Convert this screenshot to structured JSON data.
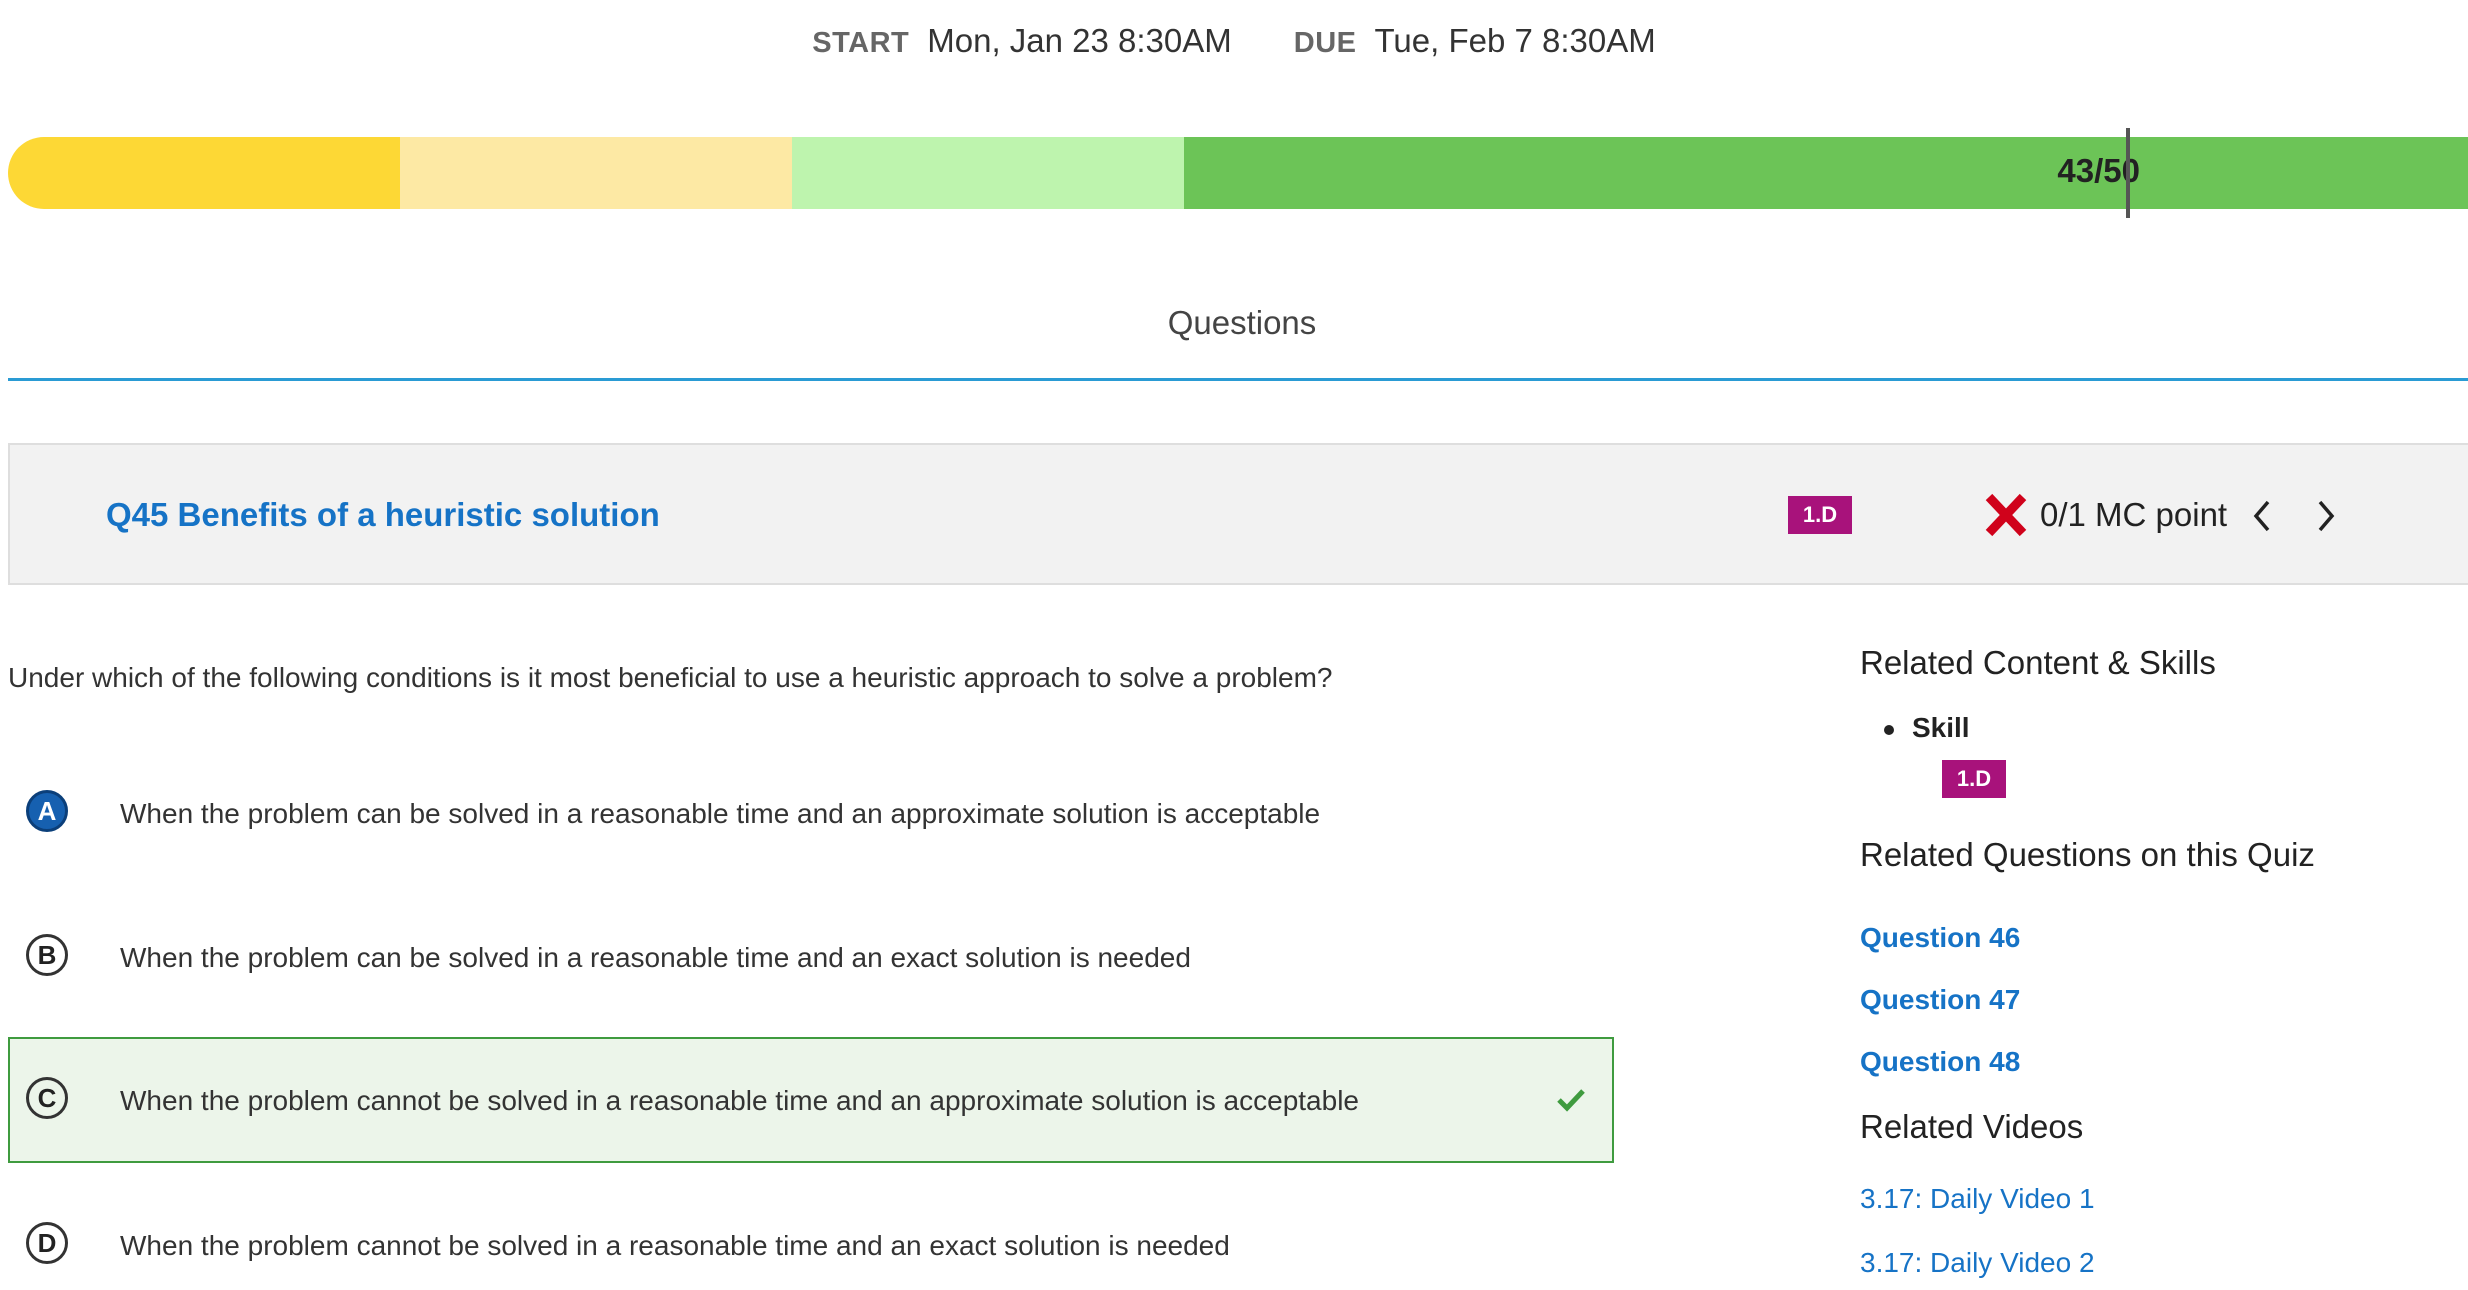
{
  "header": {
    "start_label": "START",
    "start_value": "Mon, Jan 23 8:30AM",
    "due_label": "DUE",
    "due_value": "Tue, Feb 7 8:30AM"
  },
  "progress": {
    "score_text": "43/50",
    "score": 43,
    "max": 50,
    "band_colors": [
      "#fdd835",
      "#fde9a4",
      "#bef4ae",
      "#6cc457"
    ]
  },
  "tabs": {
    "questions_label": "Questions"
  },
  "question": {
    "title": "Q45 Benefits of a heuristic solution",
    "skill_badge": "1.D",
    "result_icon": "x-icon",
    "points_text": "0/1 MC point",
    "prompt": "Under which of the following conditions is it most beneficial to use a heuristic approach to solve a problem?",
    "options": [
      {
        "letter": "A",
        "text": "When the problem can be solved in a reasonable time and an approximate solution is acceptable",
        "selected": true,
        "correct": false
      },
      {
        "letter": "B",
        "text": "When the problem can be solved in a reasonable time and an exact solution is needed",
        "selected": false,
        "correct": false
      },
      {
        "letter": "C",
        "text": "When the problem cannot be solved in a reasonable time and an approximate solution is acceptable",
        "selected": false,
        "correct": true
      },
      {
        "letter": "D",
        "text": "When the problem cannot be solved in a reasonable time and an exact solution is needed",
        "selected": false,
        "correct": false
      }
    ]
  },
  "sidebar": {
    "related_content_heading": "Related Content & Skills",
    "skill_item_label": "Skill",
    "skill_badge": "1.D",
    "related_questions_heading": "Related Questions on this Quiz",
    "related_questions": [
      "Question 46",
      "Question 47",
      "Question 48"
    ],
    "related_videos_heading": "Related Videos",
    "related_videos": [
      "3.17: Daily Video 1",
      "3.17: Daily Video 2"
    ]
  },
  "colors": {
    "link": "#1673c6",
    "badge": "#a8127b",
    "correct_border": "#3f9b3f",
    "wrong": "#d0021b"
  }
}
